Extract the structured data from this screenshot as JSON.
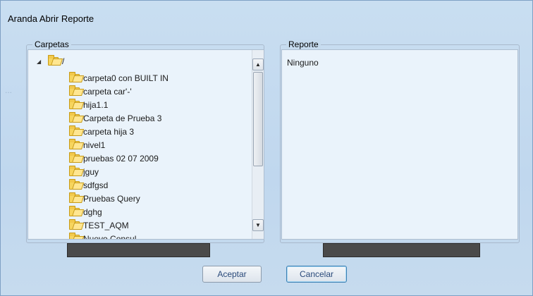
{
  "window": {
    "title": "Aranda Abrir Reporte"
  },
  "folders_group": {
    "legend": "Carpetas",
    "root": {
      "label": "/",
      "expander": "◢"
    },
    "items": [
      "carpeta0 con BUILT IN",
      "carpeta car'-'",
      "hija1.1",
      "Carpeta de Prueba 3",
      "carpeta hija 3",
      "nivel1",
      "pruebas 02 07 2009",
      "jguy",
      "sdfgsd",
      "Pruebas Query",
      "dghg",
      "TEST_AQM",
      "Nuevo Consul..."
    ],
    "scroll_up": "▲",
    "scroll_down": "▼"
  },
  "report_group": {
    "legend": "Reporte",
    "value": "Ninguno"
  },
  "inputs": {
    "folder_field": "",
    "report_field": ""
  },
  "buttons": {
    "accept": "Aceptar",
    "cancel": "Cancelar"
  },
  "icons": {
    "folder": "folder-icon"
  },
  "colors": {
    "accent": "#3c7fb1",
    "frame": "#c6dbee",
    "field_dark": "#4a4a4a",
    "folder": "#f7d55e"
  }
}
